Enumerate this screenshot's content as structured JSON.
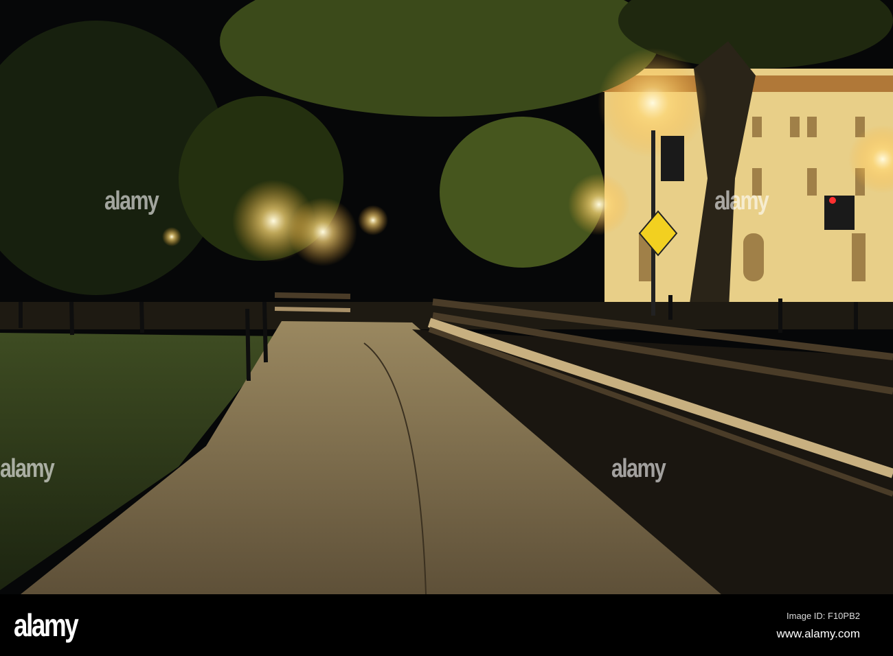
{
  "watermark": {
    "brand": "alamy"
  },
  "footer": {
    "logo": "alamy",
    "image_id": "Image ID: F10PB2",
    "website": "www.alamy.com"
  },
  "colors": {
    "sky": "#050608",
    "lamp": "#ffe9a8",
    "building": "#f0d890",
    "grass": "#2d3a18",
    "path": "#6e5e40"
  }
}
